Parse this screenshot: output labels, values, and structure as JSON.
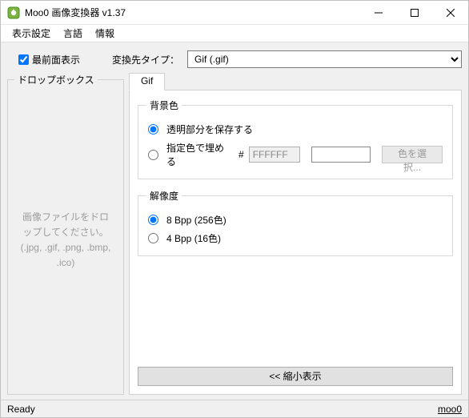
{
  "window": {
    "title": "Moo0 画像変換器 v1.37"
  },
  "menu": {
    "display_settings": "表示設定",
    "language": "言語",
    "info": "情報"
  },
  "top": {
    "topmost_label": "最前面表示",
    "topmost_checked": true,
    "convert_type_label": "変換先タイプ：",
    "selected_type": "Gif (.gif)"
  },
  "dropbox": {
    "legend": "ドロップボックス",
    "hint_l1": "画像ファイルをドロップしてください。",
    "hint_l2": "(.jpg, .gif, .png, .bmp, .ico)"
  },
  "tab": {
    "label": "Gif"
  },
  "bgcolor": {
    "legend": "背景色",
    "preserve_label": "透明部分を保存する",
    "fill_label": "指定色で埋める",
    "hash": "#",
    "hex_value": "FFFFFF",
    "pick_label": "色を選択..."
  },
  "resolution": {
    "legend": "解像度",
    "opt8_label": "8 Bpp (256色)",
    "opt4_label": "4 Bpp (16色)"
  },
  "collapse": {
    "label": "<< 縮小表示"
  },
  "status": {
    "ready": "Ready",
    "link": "moo0"
  }
}
